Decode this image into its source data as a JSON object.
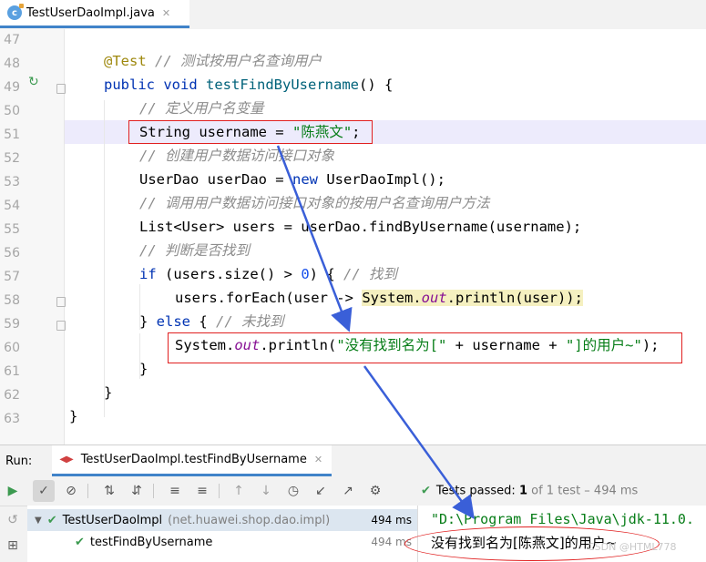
{
  "tab": {
    "title": "TestUserDaoImpl.java",
    "icon": "java-class-icon"
  },
  "editor": {
    "line_numbers": [
      "47",
      "48",
      "49",
      "50",
      "51",
      "52",
      "53",
      "54",
      "55",
      "56",
      "57",
      "58",
      "59",
      "60",
      "61",
      "62",
      "63"
    ],
    "lines": {
      "l48": {
        "annotation": "@Test",
        "comment": "// 测试按用户名查询用户"
      },
      "l49": {
        "kw1": "public",
        "kw2": "void",
        "method": "testFindByUsername",
        "rest": "() {"
      },
      "l50": {
        "comment": "// 定义用户名变量"
      },
      "l51": {
        "type": "String username = ",
        "string": "\"陈燕文\"",
        "end": ";"
      },
      "l52": {
        "comment": "// 创建用户数据访问接口对象"
      },
      "l53": {
        "start": "UserDao userDao = ",
        "kw": "new",
        "end": " UserDaoImpl();"
      },
      "l54": {
        "comment": "// 调用用户数据访问接口对象的按用户名查询用户方法"
      },
      "l55": {
        "code": "List<User> users = userDao.findByUsername(username);"
      },
      "l56": {
        "comment": "// 判断是否找到"
      },
      "l57": {
        "kw": "if",
        "mid": " (users.size() > ",
        "num": "0",
        "end": ") { ",
        "comment": "// 找到"
      },
      "l58": {
        "start": "users.forEach(user -> ",
        "sys": "System.",
        "fld": "out",
        "end": ".println(user));"
      },
      "l59": {
        "start": "} ",
        "kw": "else",
        "end": " { ",
        "comment": "// 未找到"
      },
      "l60": {
        "sys": "System.",
        "fld": "out",
        "mid": ".println(",
        "string": "\"没有找到名为[\" ",
        "plus1": "+ username + ",
        "string2": "\"]的用户~\"",
        "end": ");"
      },
      "l61": {
        "code": "}"
      },
      "l62": {
        "code": "}"
      },
      "l63": {
        "code": "}"
      }
    }
  },
  "run": {
    "label": "Run:",
    "tab_title": "TestUserDaoImpl.testFindByUsername",
    "status": {
      "prefix": "Tests passed: ",
      "count": "1",
      "suffix": " of 1 test – 494 ms"
    },
    "tree": [
      {
        "name": "TestUserDaoImpl",
        "package": "(net.huawei.shop.dao.impl)",
        "time": "494 ms"
      },
      {
        "name": "testFindByUsername",
        "time": "494 ms"
      }
    ],
    "output": {
      "path": "\"D:\\Program Files\\Java\\jdk-11.0.",
      "message": "没有找到名为[陈燕文]的用户~"
    }
  },
  "watermark": "CSDN @HTML778",
  "colors": {
    "accent": "#4083c9",
    "annotation_red": "#e12020",
    "arrow_blue": "#3a5fd8",
    "pass_green": "#3c9a50"
  }
}
